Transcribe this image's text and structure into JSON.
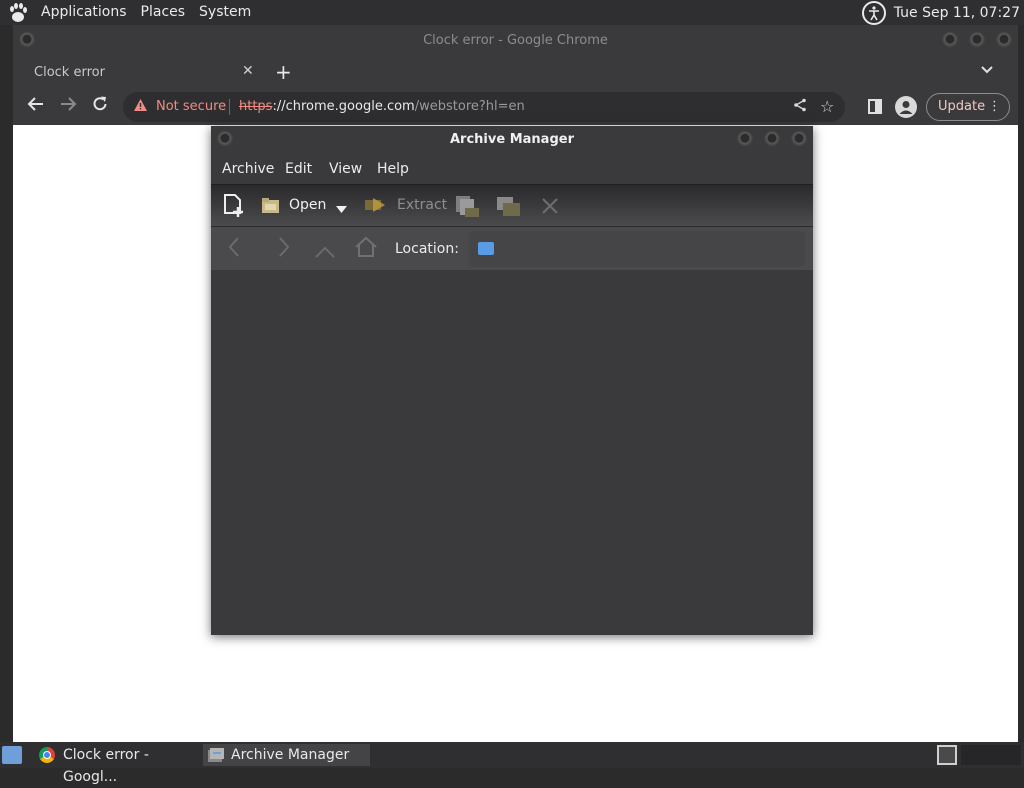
{
  "top_panel": {
    "menus": [
      "Applications",
      "Places",
      "System"
    ],
    "clock": "Tue Sep 11, 07:27"
  },
  "chrome": {
    "window_title": "Clock error - Google Chrome",
    "tab": {
      "title": "Clock error",
      "close": "✕"
    },
    "new_tab": "+",
    "tab_search": "⌄",
    "security_label": "Not secure",
    "url_scheme": "https",
    "url_host": "://chrome.google.com",
    "url_path": "/webstore?hl=en",
    "update_label": "Update"
  },
  "archive": {
    "window_title": "Archive Manager",
    "menus": {
      "archive": "Archive",
      "edit": "Edit",
      "view": "View",
      "help": "Help"
    },
    "toolbar": {
      "open": "Open",
      "extract": "Extract"
    },
    "location_label": "Location:"
  },
  "taskbar": {
    "items": [
      {
        "label": "Clock error - Googl..."
      },
      {
        "label": "Archive Manager"
      }
    ]
  },
  "colors": {
    "panel": "#2f2f31",
    "window_chrome": "#3a3a3c",
    "warning": "#f28b82",
    "folder": "#5a9be6"
  }
}
